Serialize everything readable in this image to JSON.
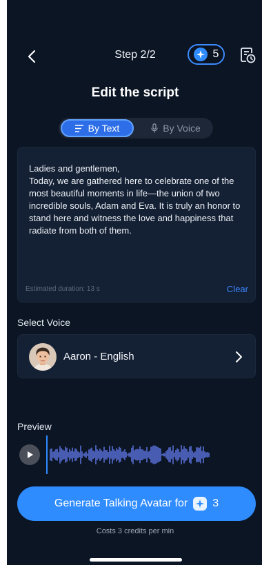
{
  "header": {
    "step": "Step 2/2",
    "credits": "5",
    "back_icon": "chevron-left-icon",
    "history_icon": "history-icon"
  },
  "page": {
    "title": "Edit the script"
  },
  "mode_tabs": [
    {
      "label": "By Text",
      "icon": "text-lines-icon",
      "selected": true
    },
    {
      "label": "By Voice",
      "icon": "microphone-icon",
      "selected": false
    }
  ],
  "script": {
    "text": "Ladies and gentlemen,\nToday, we are gathered here to celebrate one of the most beautiful moments in life—the union of two incredible souls, Adam and Eva. It is truly an honor to stand here and witness the love and happiness that radiate from both of them.",
    "estimated_duration": "Estimated duration: 13 s",
    "clear_label": "Clear"
  },
  "voice": {
    "section_label": "Select Voice",
    "selected": "Aaron - English"
  },
  "preview": {
    "label": "Preview"
  },
  "generate": {
    "label": "Generate Talking Avatar for",
    "credits": "3",
    "cost_note": "Costs 3 credits per min"
  },
  "colors": {
    "background": "#0c1524",
    "card": "#142033",
    "accent": "#2f8cff",
    "waveform": "#6a83ff"
  }
}
